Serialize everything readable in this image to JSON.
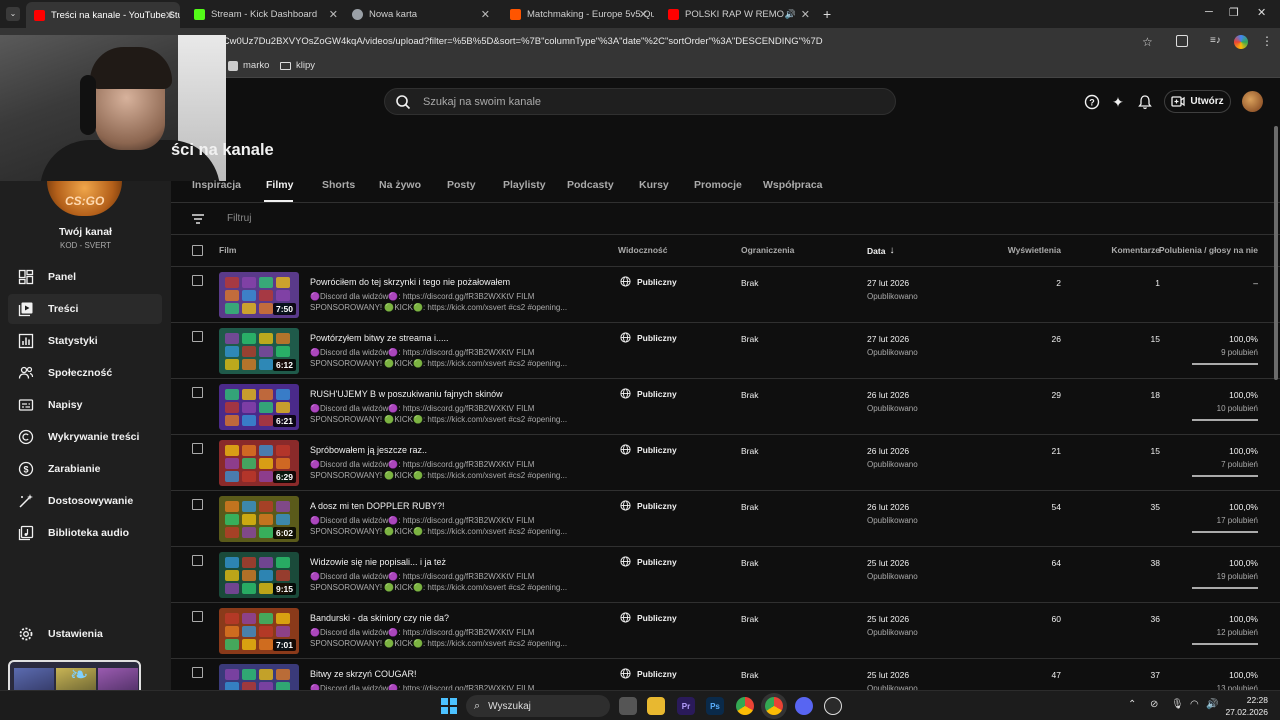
{
  "browser": {
    "tabs": [
      {
        "label": "Treści na kanale - YouTube Studio",
        "color": "#ff0000"
      },
      {
        "label": "Stream - Kick Dashboard",
        "color": "#53fc18"
      },
      {
        "label": "Nowa karta",
        "color": "#9aa0a6"
      },
      {
        "label": "Matchmaking - Europe 5v5 Qu",
        "color": "#ff5500"
      },
      {
        "label": "POLSKI RAP W REMO",
        "color": "#ff0000"
      }
    ],
    "url": "annel/UCw0Uz7Du2BXVYOsZoGW4kqA/videos/upload?filter=%5B%5D&sort=%7B\"columnType\"%3A\"date\"%2C\"sortOrder\"%3A\"DESCENDING\"%7D",
    "bookmarks": [
      "marko",
      "klipy"
    ]
  },
  "header": {
    "search_placeholder": "Szukaj na swoim kanale",
    "create_label": "Utwórz"
  },
  "sidebar": {
    "channel_logo_text": "CS:GO",
    "channel_name": "Twój kanał",
    "channel_handle": "KOD - SVERT",
    "items": [
      {
        "label": "Panel",
        "icon": "dashboard-icon"
      },
      {
        "label": "Treści",
        "icon": "content-icon"
      },
      {
        "label": "Statystyki",
        "icon": "analytics-icon"
      },
      {
        "label": "Społeczność",
        "icon": "community-icon"
      },
      {
        "label": "Napisy",
        "icon": "subtitles-icon"
      },
      {
        "label": "Wykrywanie treści",
        "icon": "copyright-icon"
      },
      {
        "label": "Zarabianie",
        "icon": "dollar-icon"
      },
      {
        "label": "Dostosowywanie",
        "icon": "magic-wand-icon"
      },
      {
        "label": "Biblioteka audio",
        "icon": "audio-library-icon"
      }
    ],
    "settings_label": "Ustawienia"
  },
  "main": {
    "title": "ści na kanale",
    "tabs": [
      "Inspiracja",
      "Filmy",
      "Shorts",
      "Na żywo",
      "Posty",
      "Playlisty",
      "Podcasty",
      "Kursy",
      "Promocje",
      "Współpraca"
    ],
    "active_tab": "Filmy",
    "filter_placeholder": "Filtruj",
    "columns": {
      "film": "Film",
      "visibility": "Widoczność",
      "restrictions": "Ograniczenia",
      "date": "Data",
      "views": "Wyświetlenia",
      "comments": "Komentarze",
      "likes": "Polubienia / głosy na nie"
    },
    "desc_line": "🟣Discord dla widzów🟣: https://discord.gg/fR3B2WXKtV FILM SPONSOROWANY! 🟢KICK🟢: https://kick.com/xsvert #cs2 #opening...",
    "videos": [
      {
        "title": "Powróciłem do tej skrzynki i tego nie pożałowałem",
        "duration": "7:50",
        "visibility": "Publiczny",
        "restrictions": "Brak",
        "date": "27 lut 2026",
        "status": "Opublikowano",
        "views": "2",
        "comments": "1",
        "likes": "–",
        "like_count": "",
        "theme": "#5a3a8a"
      },
      {
        "title": "Powtórzyłem bitwy ze streama i.....",
        "duration": "6:12",
        "visibility": "Publiczny",
        "restrictions": "Brak",
        "date": "27 lut 2026",
        "status": "Opublikowano",
        "views": "26",
        "comments": "15",
        "likes": "100,0%",
        "like_count": "9 polubień",
        "theme": "#1f5a4a"
      },
      {
        "title": "RUSH'UJEMY B w poszukiwaniu fajnych skinów",
        "duration": "6:21",
        "visibility": "Publiczny",
        "restrictions": "Brak",
        "date": "26 lut 2026",
        "status": "Opublikowano",
        "views": "29",
        "comments": "18",
        "likes": "100,0%",
        "like_count": "10 polubień",
        "theme": "#4a2a8a"
      },
      {
        "title": "Spróbowałem ją jeszcze raz..",
        "duration": "6:29",
        "visibility": "Publiczny",
        "restrictions": "Brak",
        "date": "26 lut 2026",
        "status": "Opublikowano",
        "views": "21",
        "comments": "15",
        "likes": "100,0%",
        "like_count": "7 polubień",
        "theme": "#8a2a2a"
      },
      {
        "title": "A dosz mi ten DOPPLER RUBY?!",
        "duration": "6:02",
        "visibility": "Publiczny",
        "restrictions": "Brak",
        "date": "26 lut 2026",
        "status": "Opublikowano",
        "views": "54",
        "comments": "35",
        "likes": "100,0%",
        "like_count": "17 polubień",
        "theme": "#5a5a1a"
      },
      {
        "title": "Widzowie się nie popisali... i ja też",
        "duration": "9:15",
        "visibility": "Publiczny",
        "restrictions": "Brak",
        "date": "25 lut 2026",
        "status": "Opublikowano",
        "views": "64",
        "comments": "38",
        "likes": "100,0%",
        "like_count": "19 polubień",
        "theme": "#1a4a3a"
      },
      {
        "title": "Bandurski - da skiniory czy nie da?",
        "duration": "7:01",
        "visibility": "Publiczny",
        "restrictions": "Brak",
        "date": "25 lut 2026",
        "status": "Opublikowano",
        "views": "60",
        "comments": "36",
        "likes": "100,0%",
        "like_count": "12 polubień",
        "theme": "#8a3a1a"
      },
      {
        "title": "Bitwy ze skrzyń COUGAR!",
        "duration": "",
        "visibility": "Publiczny",
        "restrictions": "Brak",
        "date": "25 lut 2026",
        "status": "Opublikowano",
        "views": "47",
        "comments": "37",
        "likes": "100,0%",
        "like_count": "13 polubień",
        "theme": "#3a3a7a"
      }
    ]
  },
  "taskbar": {
    "search_label": "Wyszukaj",
    "time": "22:28",
    "date": "27.02.2026"
  }
}
